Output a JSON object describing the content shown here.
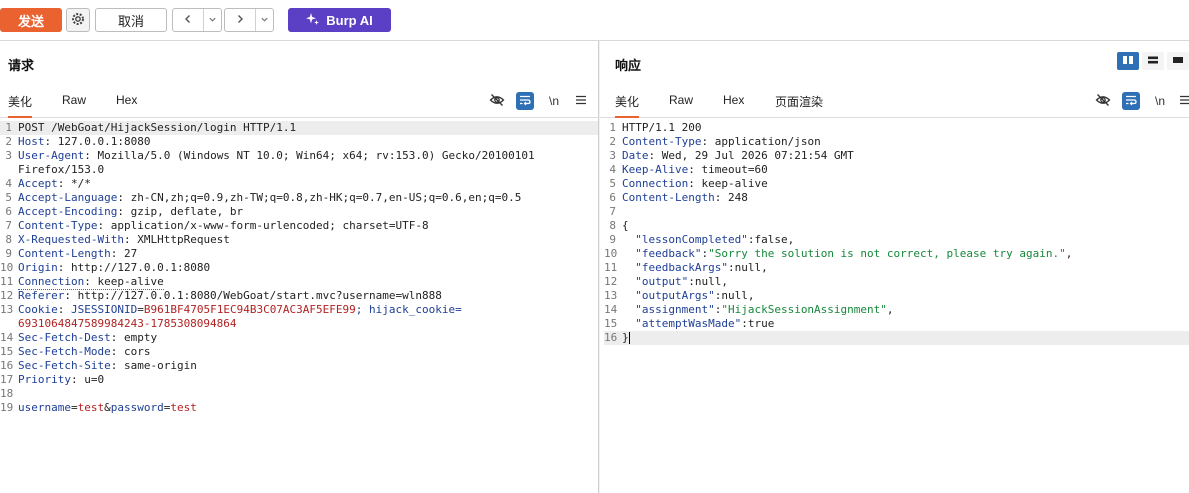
{
  "toolbar": {
    "send_label": "发送",
    "cancel_label": "取消",
    "burp_ai_label": "Burp AI",
    "gear_icon": "gear-icon",
    "back_icon": "chevron-left-icon",
    "forward_icon": "chevron-right-icon",
    "dropdown_icon": "chevron-down-icon",
    "colors": {
      "send": "#e9622f",
      "burp_ai": "#5b3fc4",
      "accent": "#2f6fb5"
    }
  },
  "request": {
    "title": "请求",
    "tabs": [
      "美化",
      "Raw",
      "Hex"
    ],
    "active_tab": "美化",
    "newline_label": "\\n",
    "lines": [
      {
        "n": "1",
        "text": "POST /WebGoat/HijackSession/login HTTP/1.1"
      },
      {
        "n": "2",
        "name": "Host",
        "value": " 127.0.0.1:8080"
      },
      {
        "n": "3",
        "name": "User-Agent",
        "value": " Mozilla/5.0 (Windows NT 10.0; Win64; x64; rv:153.0) Gecko/20100101",
        "cont": "Firefox/153.0"
      },
      {
        "n": "4",
        "name": "Accept",
        "value": " */*"
      },
      {
        "n": "5",
        "name": "Accept-Language",
        "value": " zh-CN,zh;q=0.9,zh-TW;q=0.8,zh-HK;q=0.7,en-US;q=0.6,en;q=0.5"
      },
      {
        "n": "6",
        "name": "Accept-Encoding",
        "value": " gzip, deflate, br"
      },
      {
        "n": "7",
        "name": "Content-Type",
        "value": " application/x-www-form-urlencoded; charset=UTF-8"
      },
      {
        "n": "8",
        "name": "X-Requested-With",
        "value": " XMLHttpRequest"
      },
      {
        "n": "9",
        "name": "Content-Length",
        "value": " 27"
      },
      {
        "n": "10",
        "name": "Origin",
        "value": " http://127.0.0.1:8080"
      },
      {
        "n": "11",
        "name": "Connection",
        "value": " keep-alive"
      },
      {
        "n": "12",
        "name": "Referer",
        "value": " http://127.0.0.1:8080/WebGoat/start.mvc?username=wln888"
      },
      {
        "n": "13",
        "name": "Cookie",
        "c1n": " JSESSIONID",
        "c1v": "B961BF4705F1EC94B3C07AC3AF5EFE99",
        "c2n": "; hijack_cookie",
        "c2v": "=",
        "cont": "6931064847589984243-1785308094864"
      },
      {
        "n": "14",
        "name": "Sec-Fetch-Dest",
        "value": " empty"
      },
      {
        "n": "15",
        "name": "Sec-Fetch-Mode",
        "value": " cors"
      },
      {
        "n": "16",
        "name": "Sec-Fetch-Site",
        "value": " same-origin"
      },
      {
        "n": "17",
        "name": "Priority",
        "value": " u=0"
      },
      {
        "n": "18"
      },
      {
        "n": "19",
        "p1n": "username",
        "p1v": "test",
        "p2n": "password",
        "p2v": "test"
      }
    ]
  },
  "response": {
    "title": "响应",
    "tabs": [
      "美化",
      "Raw",
      "Hex",
      "页面渲染"
    ],
    "active_tab": "美化",
    "newline_label": "\\n",
    "lines": [
      {
        "n": "1",
        "text": "HTTP/1.1 200"
      },
      {
        "n": "2",
        "name": "Content-Type",
        "value": " application/json"
      },
      {
        "n": "3",
        "name": "Date",
        "value": " Wed, 29 Jul 2026 07:21:54 GMT"
      },
      {
        "n": "4",
        "name": "Keep-Alive",
        "value": " timeout=60"
      },
      {
        "n": "5",
        "name": "Connection",
        "value": " keep-alive"
      },
      {
        "n": "6",
        "name": "Content-Length",
        "value": " 248"
      },
      {
        "n": "7"
      },
      {
        "n": "8",
        "text": "{"
      },
      {
        "n": "9",
        "key": "  \"lessonCompleted\"",
        "val": ":false,"
      },
      {
        "n": "10",
        "key": "  \"feedback\"",
        "sval": "\"Sorry the solution is not correct, please try again.\"",
        "tail": ","
      },
      {
        "n": "11",
        "key": "  \"feedbackArgs\"",
        "val": ":null,"
      },
      {
        "n": "12",
        "key": "  \"output\"",
        "val": ":null,"
      },
      {
        "n": "13",
        "key": "  \"outputArgs\"",
        "val": ":null,"
      },
      {
        "n": "14",
        "key": "  \"assignment\"",
        "sval": "\"HijackSessionAssignment\"",
        "tail": ","
      },
      {
        "n": "15",
        "key": "  \"attemptWasMade\"",
        "val": ":true"
      },
      {
        "n": "16",
        "text": "}"
      }
    ]
  }
}
